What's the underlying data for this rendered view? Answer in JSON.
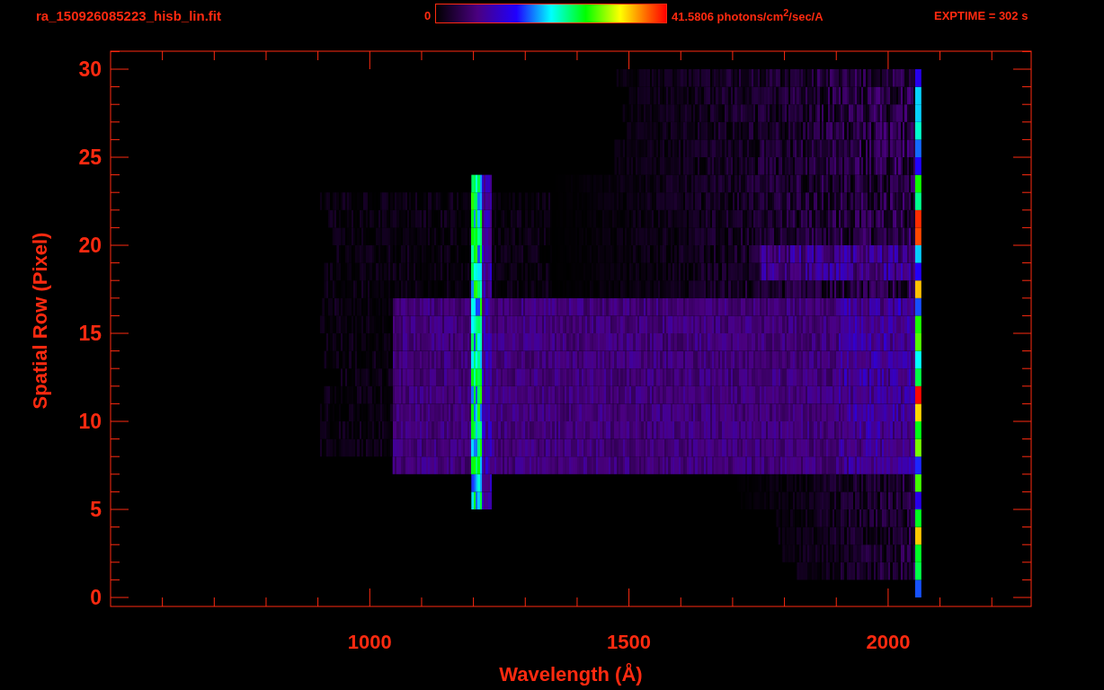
{
  "header": {
    "filename": "ra_150926085223_hisb_lin.fit",
    "colorbar": {
      "min": "0",
      "max": "41.5806 photons/cm$^{2}$/sec/A"
    },
    "exposure": "EXPTIME = 302 s"
  },
  "plot": {
    "ylabel": "Spatial Row (Pixel)",
    "xlabel": "Wavelength (Å)",
    "yticks": [
      "30",
      "25",
      "20",
      "15",
      "10",
      "5",
      "0"
    ],
    "xticks": [
      "1000",
      "1500",
      "2000"
    ]
  }
}
